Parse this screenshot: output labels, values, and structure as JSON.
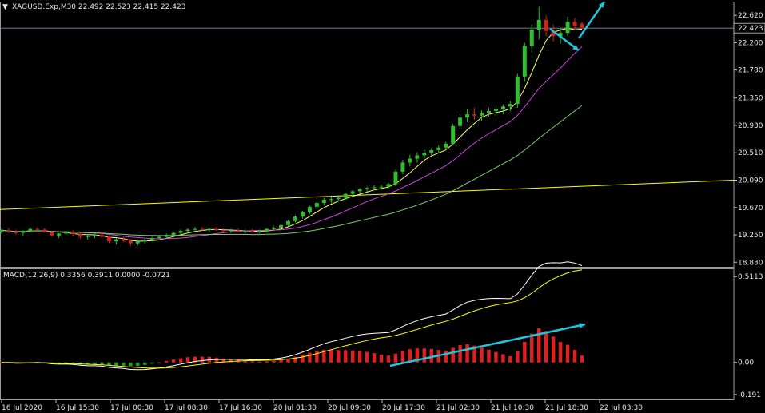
{
  "chart_data": [
    {
      "type": "candlestick",
      "header": "XAGUSD.Exp,M30  22.492 22.523 22.415 22.423",
      "symbol_arrow": "▼",
      "price_ticks": [
        "22.620",
        "22.200",
        "21.780",
        "21.350",
        "20.930",
        "20.510",
        "20.090",
        "19.670",
        "19.250",
        "18.830"
      ],
      "current_price": "22.423",
      "ylim": [
        18.76,
        22.83
      ],
      "x_labels": [
        "16 Jul 2020",
        "16 Jul 15:30",
        "17 Jul 00:30",
        "17 Jul 08:30",
        "17 Jul 16:30",
        "20 Jul 01:30",
        "20 Jul 09:30",
        "20 Jul 17:30",
        "21 Jul 02:30",
        "21 Jul 10:30",
        "21 Jul 18:30",
        "22 Jul 03:30"
      ],
      "candles": [
        [
          19.3,
          19.34,
          19.27,
          19.32
        ],
        [
          19.32,
          19.36,
          19.28,
          19.3
        ],
        [
          19.3,
          19.33,
          19.25,
          19.28
        ],
        [
          19.28,
          19.32,
          19.24,
          19.31
        ],
        [
          19.31,
          19.36,
          19.29,
          19.34
        ],
        [
          19.34,
          19.37,
          19.3,
          19.33
        ],
        [
          19.33,
          19.35,
          19.28,
          19.29
        ],
        [
          19.29,
          19.31,
          19.22,
          19.24
        ],
        [
          19.24,
          19.28,
          19.2,
          19.27
        ],
        [
          19.27,
          19.31,
          19.25,
          19.29
        ],
        [
          19.29,
          19.32,
          19.24,
          19.26
        ],
        [
          19.26,
          19.29,
          19.19,
          19.22
        ],
        [
          19.22,
          19.26,
          19.18,
          19.23
        ],
        [
          19.23,
          19.27,
          19.2,
          19.25
        ],
        [
          19.25,
          19.28,
          19.21,
          19.22
        ],
        [
          19.22,
          19.24,
          19.12,
          19.15
        ],
        [
          19.15,
          19.2,
          19.1,
          19.18
        ],
        [
          19.18,
          19.22,
          19.14,
          19.16
        ],
        [
          19.16,
          19.19,
          19.08,
          19.12
        ],
        [
          19.12,
          19.17,
          19.09,
          19.15
        ],
        [
          19.15,
          19.19,
          19.12,
          19.17
        ],
        [
          19.17,
          19.22,
          19.15,
          19.2
        ],
        [
          19.2,
          19.24,
          19.18,
          19.22
        ],
        [
          19.22,
          19.27,
          19.2,
          19.25
        ],
        [
          19.25,
          19.3,
          19.23,
          19.28
        ],
        [
          19.28,
          19.33,
          19.26,
          19.31
        ],
        [
          19.31,
          19.35,
          19.28,
          19.33
        ],
        [
          19.33,
          19.37,
          19.3,
          19.34
        ],
        [
          19.34,
          19.37,
          19.31,
          19.33
        ],
        [
          19.33,
          19.36,
          19.3,
          19.34
        ],
        [
          19.34,
          19.37,
          19.31,
          19.32
        ],
        [
          19.32,
          19.35,
          19.29,
          19.31
        ],
        [
          19.31,
          19.34,
          19.28,
          19.32
        ],
        [
          19.32,
          19.35,
          19.29,
          19.3
        ],
        [
          19.3,
          19.33,
          19.27,
          19.31
        ],
        [
          19.31,
          19.34,
          19.28,
          19.29
        ],
        [
          19.29,
          19.33,
          19.27,
          19.31
        ],
        [
          19.31,
          19.35,
          19.29,
          19.34
        ],
        [
          19.34,
          19.38,
          19.32,
          19.36
        ],
        [
          19.36,
          19.42,
          19.34,
          19.4
        ],
        [
          19.4,
          19.48,
          19.38,
          19.46
        ],
        [
          19.46,
          19.55,
          19.44,
          19.53
        ],
        [
          19.53,
          19.62,
          19.5,
          19.6
        ],
        [
          19.6,
          19.7,
          19.57,
          19.68
        ],
        [
          19.68,
          19.78,
          19.64,
          19.74
        ],
        [
          19.74,
          19.82,
          19.7,
          19.79
        ],
        [
          19.79,
          19.84,
          19.74,
          19.8
        ],
        [
          19.8,
          19.86,
          19.76,
          19.82
        ],
        [
          19.82,
          19.9,
          19.79,
          19.88
        ],
        [
          19.88,
          19.94,
          19.84,
          19.92
        ],
        [
          19.92,
          19.97,
          19.88,
          19.95
        ],
        [
          19.95,
          19.99,
          19.91,
          19.97
        ],
        [
          19.97,
          20.01,
          19.93,
          19.98
        ],
        [
          19.98,
          20.02,
          19.94,
          19.99
        ],
        [
          19.99,
          20.05,
          19.96,
          20.03
        ],
        [
          20.03,
          20.25,
          20.0,
          20.22
        ],
        [
          20.22,
          20.4,
          20.18,
          20.36
        ],
        [
          20.36,
          20.48,
          20.3,
          20.42
        ],
        [
          20.42,
          20.52,
          20.36,
          20.47
        ],
        [
          20.47,
          20.56,
          20.42,
          20.51
        ],
        [
          20.51,
          20.58,
          20.46,
          20.55
        ],
        [
          20.55,
          20.62,
          20.5,
          20.59
        ],
        [
          20.59,
          20.68,
          20.55,
          20.65
        ],
        [
          20.65,
          20.95,
          20.62,
          20.92
        ],
        [
          20.92,
          21.1,
          20.88,
          21.05
        ],
        [
          21.05,
          21.18,
          20.98,
          21.1
        ],
        [
          21.1,
          21.2,
          21.02,
          21.08
        ],
        [
          21.08,
          21.16,
          21.0,
          21.12
        ],
        [
          21.12,
          21.2,
          21.06,
          21.15
        ],
        [
          21.15,
          21.22,
          21.08,
          21.18
        ],
        [
          21.18,
          21.25,
          21.1,
          21.22
        ],
        [
          21.22,
          21.3,
          21.15,
          21.26
        ],
        [
          21.26,
          21.72,
          21.2,
          21.68
        ],
        [
          21.68,
          22.2,
          21.6,
          22.15
        ],
        [
          22.15,
          22.48,
          22.05,
          22.4
        ],
        [
          22.4,
          22.75,
          22.25,
          22.55
        ],
        [
          22.55,
          22.62,
          22.3,
          22.38
        ],
        [
          22.38,
          22.48,
          22.22,
          22.3
        ],
        [
          22.3,
          22.42,
          22.18,
          22.35
        ],
        [
          22.35,
          22.6,
          22.3,
          22.52
        ],
        [
          22.52,
          22.58,
          22.4,
          22.45
        ],
        [
          22.492,
          22.523,
          22.415,
          22.423
        ]
      ],
      "ma_series": [
        {
          "color": "#ffff66",
          "period": 5
        },
        {
          "color": "#cc44dd",
          "period": 12
        },
        {
          "color": "#7acd6a",
          "period": 30
        }
      ],
      "trendline": {
        "color": "#ffff00",
        "start": [
          0,
          19.64
        ],
        "end": [
          81,
          20.09
        ]
      },
      "arrows_color": "#22c3dc"
    },
    {
      "type": "macd",
      "header": "MACD(12,26,9) 0.3356 0.3911 0.0000 -0.0721",
      "ticks": [
        "0.5113",
        "0.00",
        "-0.191"
      ],
      "ylim": [
        -0.22,
        0.56
      ],
      "colors": {
        "main": "#ffffff",
        "signal": "#ffff00",
        "hist_up": "#e02020",
        "hist_down": "#1ea01e",
        "arrow": "#22c3dc"
      }
    }
  ]
}
